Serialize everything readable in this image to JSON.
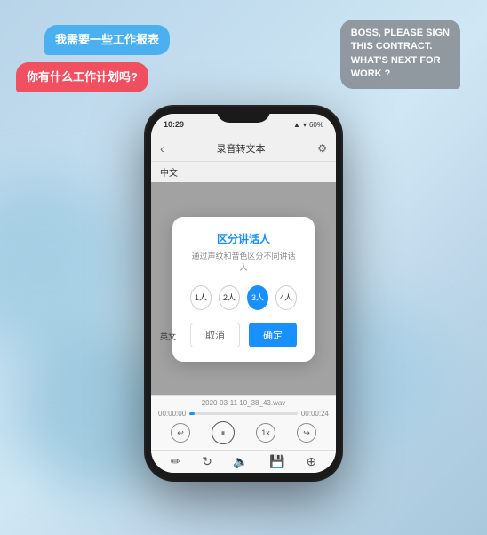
{
  "background": {
    "color_start": "#b8d4e8",
    "color_end": "#a8c8dc"
  },
  "bubbles": {
    "bubble1": {
      "text": "我需要一些工作报表",
      "color": "#4ab0f0",
      "position": "top-left"
    },
    "bubble2": {
      "text": "你有什么工作计划吗?",
      "color": "#f05060",
      "position": "middle-left"
    },
    "bubble3": {
      "text_line1": "BOSS, PLEASE SIGN",
      "text_line2": "THIS CONTRACT.",
      "text_line3": "WHAT'S NEXT FOR",
      "text_line4": "WORK ?",
      "color": "#9098a0",
      "position": "top-right"
    }
  },
  "phone": {
    "status_bar": {
      "time": "10:29",
      "signal": "▲▽",
      "wifi": "wifi",
      "battery": "60%"
    },
    "header": {
      "back_icon": "‹",
      "title": "录音转文本",
      "settings_icon": "⚙"
    },
    "lang_label_cn": "中文",
    "lang_label_en": "英文",
    "dialog": {
      "title": "区分讲话人",
      "subtitle": "通过声纹和音色区分不同讲话人",
      "speakers": [
        "1人",
        "2人",
        "3人",
        "4人"
      ],
      "active_index": 2,
      "cancel_label": "取消",
      "confirm_label": "确定"
    },
    "bottom": {
      "file_name": "2020-03-11 10_38_43.wav",
      "time_start": "00:00:00",
      "time_end": "00:00:24",
      "controls": {
        "rewind_icon": "↩",
        "play_icon": "⏸",
        "speed_icon": "1x",
        "forward_icon": "↪"
      },
      "tools": {
        "edit_icon": "✏",
        "refresh_icon": "↻",
        "volume_icon": "🔈",
        "save_icon": "💾",
        "expand_icon": "⊕"
      }
    }
  }
}
